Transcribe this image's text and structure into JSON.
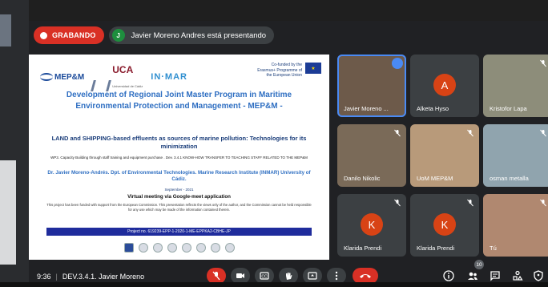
{
  "recording_label": "GRABANDO",
  "presenter": {
    "initial": "J",
    "text": "Javier Moreno Andres está presentando"
  },
  "slide": {
    "logo_mep": "MEP&M",
    "logo_uca": "UCA",
    "logo_uca_sub": "Universidad de Cádiz",
    "logo_inmar": "IN·MAR",
    "eu_text": "Co-funded by the Erasmus+ Programme of the European Union",
    "title": "Development of Regional Joint Master Program in Maritime Environmental Protection and Management - MEP&M -",
    "subtitle": "LAND and SHIPPING-based effluents as sources of marine pollution: Technologies for its minimization",
    "wp": "WP3. Capacity Building through staff training and equipment purchase . Dev. 3.4.1 KNOW-HOW TRANSFER TO TEACHING STAFF RELATED TO THE MEP&M",
    "author": "Dr. Javier Moreno-Andrés. Dpt. of Environmental Technologies. Marine Research Institute (INMAR) University of Cádiz.",
    "date": "September - 2021",
    "meeting": "Virtual meeting via Google-meet application",
    "disclaimer": "This project has been funded with support from the European Commission. This presentation reflects the views only of the author, and the Commission cannot be held responsible for any use which may be made of the information contained therein.",
    "project": "Project no. 619239-EPP-1-2020-1-ME-EPPKA2-CBHE-JP"
  },
  "participants": [
    {
      "name": "Javier Moreno ...",
      "initial": "",
      "avatar_color": "#6d5a4a",
      "muted": false,
      "speaking": true
    },
    {
      "name": "Alketa Hyso",
      "initial": "A",
      "avatar_color": "#d84315",
      "muted": false,
      "speaking": false
    },
    {
      "name": "Kristofor Lapa",
      "initial": "",
      "avatar_color": "#8d8d7a",
      "muted": true,
      "speaking": false
    },
    {
      "name": "Danilo Nikolic",
      "initial": "",
      "avatar_color": "#7a6a58",
      "muted": true,
      "speaking": false
    },
    {
      "name": "UoM MEP&M",
      "initial": "",
      "avatar_color": "#b89a7a",
      "muted": true,
      "speaking": false
    },
    {
      "name": "osman metalla",
      "initial": "",
      "avatar_color": "#90a4ae",
      "muted": true,
      "speaking": false
    },
    {
      "name": "Klarida Prendi",
      "initial": "K",
      "avatar_color": "#d84315",
      "muted": true,
      "speaking": false
    },
    {
      "name": "Klarida Prendi",
      "initial": "K",
      "avatar_color": "#d84315",
      "muted": true,
      "speaking": false
    },
    {
      "name": "Tú",
      "initial": "",
      "avatar_color": "#b08870",
      "muted": true,
      "speaking": false
    }
  ],
  "bottom": {
    "time": "9:36",
    "meeting_name": "DEV.3.4.1. Javier Moreno",
    "participant_count": "10"
  },
  "colors": {
    "recording": "#d93025",
    "accent": "#4a8af4",
    "bar": "#202124"
  }
}
